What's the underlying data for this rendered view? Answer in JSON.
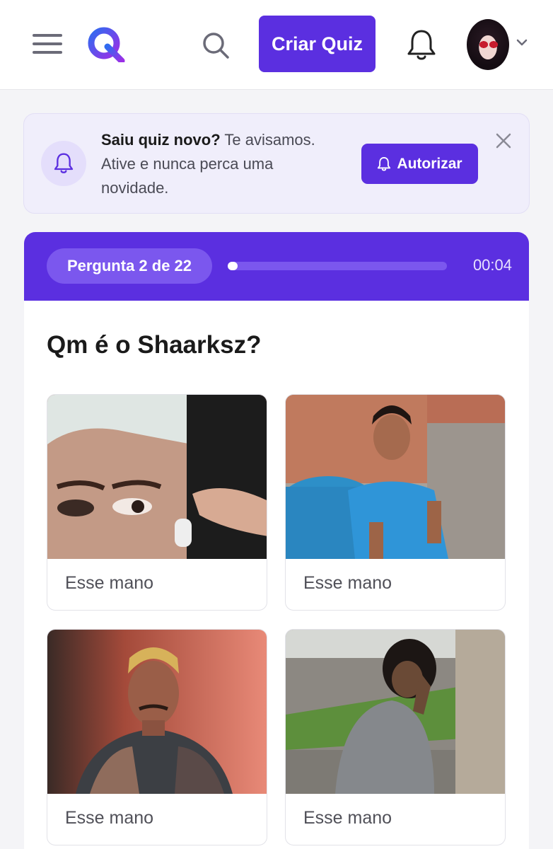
{
  "header": {
    "create_label": "Criar Quiz",
    "colors": {
      "accent": "#5b2fe0",
      "accent_light": "#7b57ee"
    },
    "icons": [
      "menu-icon",
      "logo-q",
      "search-icon",
      "bell-icon",
      "avatar",
      "chevron-down-icon"
    ]
  },
  "banner": {
    "title": "Saiu quiz novo?",
    "body": " Te avisamos. Ative e nunca perca uma novidade.",
    "authorize_label": "Autorizar"
  },
  "quiz": {
    "question_counter": "Pergunta 2 de 22",
    "progress": 0.04,
    "timer": "00:04",
    "question": "Qm é o Shaarksz?",
    "options": [
      {
        "label": "Esse mano"
      },
      {
        "label": "Esse mano"
      },
      {
        "label": "Esse mano"
      },
      {
        "label": "Esse mano"
      }
    ]
  }
}
